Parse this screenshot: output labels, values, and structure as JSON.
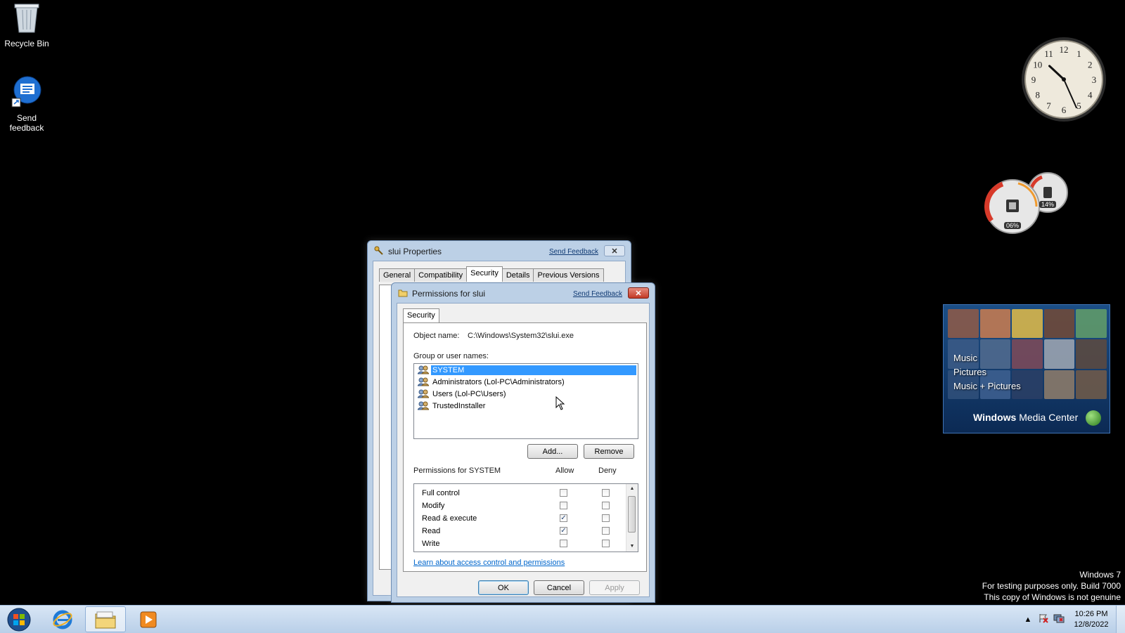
{
  "desktop": {
    "icons": [
      {
        "label": "Recycle Bin",
        "icon": "recycle-bin-icon"
      },
      {
        "label": "Send feedback",
        "icon": "send-feedback-icon"
      }
    ]
  },
  "gadgets": {
    "clock": {
      "hour": 10,
      "minute": 26
    },
    "cpu_meter": {
      "cpu_label": "06%",
      "memory_label": "14%"
    },
    "media_center": {
      "menu": [
        "Music",
        "Pictures",
        "Music + Pictures"
      ],
      "brand_bold": "Windows",
      "brand_rest": " Media Center"
    }
  },
  "watermark": {
    "line1": "Windows 7",
    "line2": "For testing purposes only. Build 7000",
    "line3": "This copy of Windows is not genuine"
  },
  "slui_properties": {
    "title": "slui Properties",
    "send_feedback": "Send Feedback",
    "tabs": [
      {
        "label": "General",
        "active": false
      },
      {
        "label": "Compatibility",
        "active": false
      },
      {
        "label": "Security",
        "active": true
      },
      {
        "label": "Details",
        "active": false
      },
      {
        "label": "Previous Versions",
        "active": false
      }
    ]
  },
  "permissions_dialog": {
    "title": "Permissions for slui",
    "send_feedback": "Send Feedback",
    "tab": "Security",
    "object_name_label": "Object name:",
    "object_name_value": "C:\\Windows\\System32\\slui.exe",
    "group_label": "Group or user names:",
    "users": [
      {
        "name": "SYSTEM",
        "selected": true
      },
      {
        "name": "Administrators (Lol-PC\\Administrators)",
        "selected": false
      },
      {
        "name": "Users (Lol-PC\\Users)",
        "selected": false
      },
      {
        "name": "TrustedInstaller",
        "selected": false
      }
    ],
    "add_button": "Add...",
    "remove_button": "Remove",
    "permissions_label": "Permissions for SYSTEM",
    "allow_header": "Allow",
    "deny_header": "Deny",
    "permissions": [
      {
        "name": "Full control",
        "allow": false,
        "deny": false
      },
      {
        "name": "Modify",
        "allow": false,
        "deny": false
      },
      {
        "name": "Read & execute",
        "allow": true,
        "deny": false
      },
      {
        "name": "Read",
        "allow": true,
        "deny": false
      },
      {
        "name": "Write",
        "allow": false,
        "deny": false
      }
    ],
    "learn_link": "Learn about access control and permissions",
    "ok_button": "OK",
    "cancel_button": "Cancel",
    "apply_button": "Apply"
  },
  "taskbar": {
    "time": "10:26 PM",
    "date": "12/8/2022",
    "apps": [
      "start-orb-icon",
      "internet-explorer-icon",
      "windows-explorer-icon",
      "media-player-icon"
    ]
  }
}
